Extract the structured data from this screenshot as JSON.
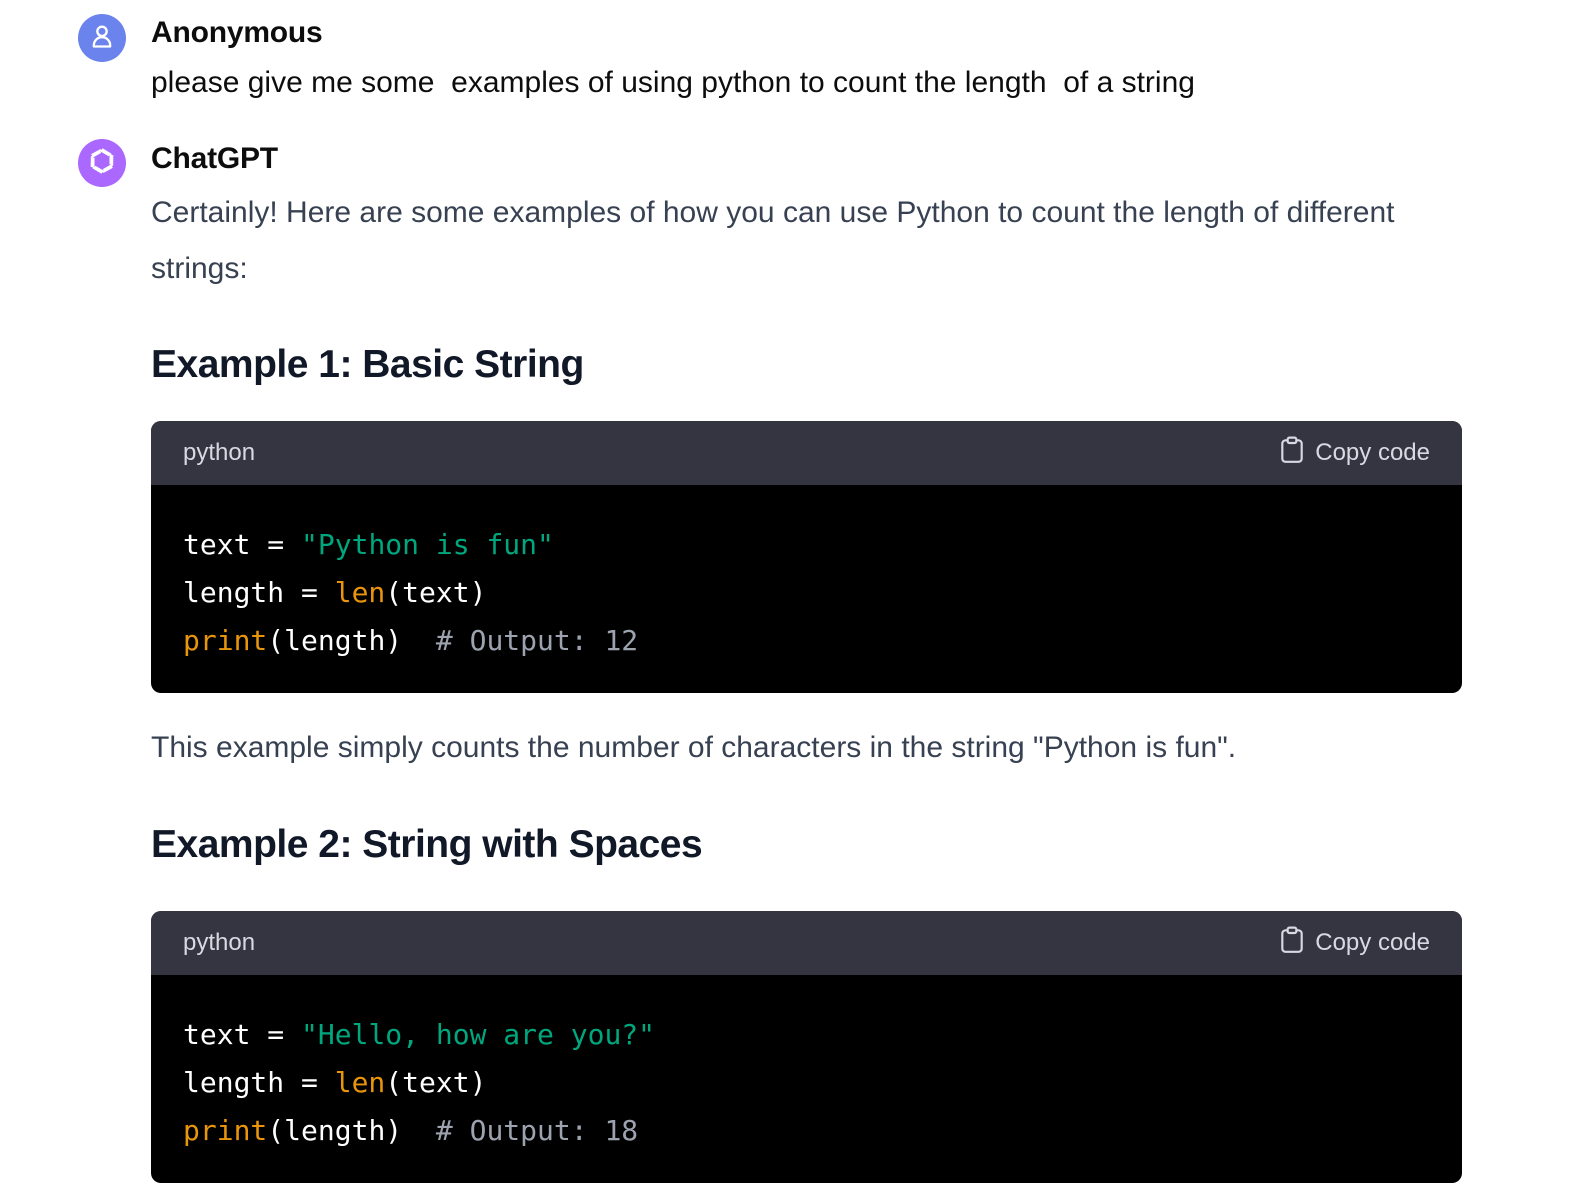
{
  "user_message": {
    "author": "Anonymous",
    "avatar_icon": "user-icon",
    "text": "please give me some  examples of using python to count the length  of a string"
  },
  "assistant_message": {
    "author": "ChatGPT",
    "avatar_icon": "openai-logo-icon",
    "intro": "Certainly! Here are some examples of how you can use Python to count the length of different strings:",
    "examples": [
      {
        "heading": "Example 1: Basic String",
        "code_language": "python",
        "copy_label": "Copy code",
        "lines": [
          [
            {
              "t": "text = ",
              "k": "plain"
            },
            {
              "t": "\"Python is fun\"",
              "k": "str"
            }
          ],
          [
            {
              "t": "length = ",
              "k": "plain"
            },
            {
              "t": "len",
              "k": "fn"
            },
            {
              "t": "(text)",
              "k": "plain"
            }
          ],
          [
            {
              "t": "print",
              "k": "fn"
            },
            {
              "t": "(length)  ",
              "k": "plain"
            },
            {
              "t": "# Output: 12",
              "k": "com"
            }
          ]
        ],
        "after_text": "This example simply counts the number of characters in the string \"Python is fun\"."
      },
      {
        "heading": "Example 2: String with Spaces",
        "code_language": "python",
        "copy_label": "Copy code",
        "lines": [
          [
            {
              "t": "text = ",
              "k": "plain"
            },
            {
              "t": "\"Hello, how are you?\"",
              "k": "str"
            }
          ],
          [
            {
              "t": "length = ",
              "k": "plain"
            },
            {
              "t": "len",
              "k": "fn"
            },
            {
              "t": "(text)",
              "k": "plain"
            }
          ],
          [
            {
              "t": "print",
              "k": "fn"
            },
            {
              "t": "(length)  ",
              "k": "plain"
            },
            {
              "t": "# Output: 18",
              "k": "com"
            }
          ]
        ]
      }
    ]
  },
  "colors": {
    "code_string": "#00a67d",
    "code_function": "#e9950c",
    "code_comment": "#9ca3af",
    "code_header_bg": "#343541",
    "user_avatar_bg": "#6b83ec",
    "assistant_avatar_bg": "#ab68ff"
  }
}
